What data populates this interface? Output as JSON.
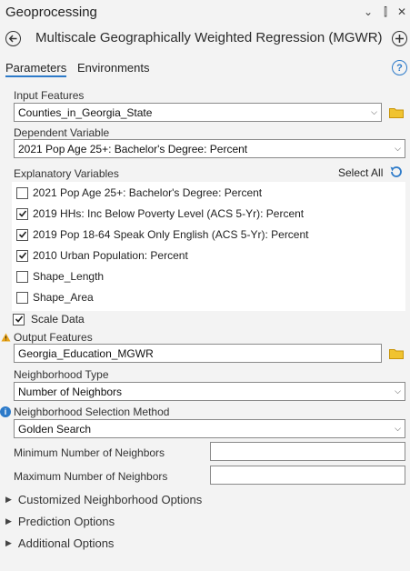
{
  "header": {
    "title": "Geoprocessing",
    "controls": [
      "⌄",
      "⫿",
      "✕"
    ]
  },
  "tool": {
    "title": "Multiscale Geographically Weighted Regression (MGWR)"
  },
  "tabs": [
    {
      "label": "Parameters",
      "active": true
    },
    {
      "label": "Environments",
      "active": false
    }
  ],
  "params": {
    "input_features": {
      "label": "Input Features",
      "value": "Counties_in_Georgia_State"
    },
    "dependent_variable": {
      "label": "Dependent Variable",
      "value": "2021 Pop Age 25+: Bachelor's Degree: Percent"
    },
    "explanatory": {
      "label": "Explanatory Variables",
      "select_all": "Select All",
      "items": [
        {
          "label": "2021 Pop Age 25+: Bachelor's Degree: Percent",
          "checked": false
        },
        {
          "label": "2019 HHs: Inc Below Poverty Level (ACS 5-Yr): Percent",
          "checked": true
        },
        {
          "label": "2019 Pop 18-64 Speak Only English (ACS 5-Yr): Percent",
          "checked": true
        },
        {
          "label": "2010 Urban Population: Percent",
          "checked": true
        },
        {
          "label": "Shape_Length",
          "checked": false
        },
        {
          "label": "Shape_Area",
          "checked": false
        }
      ]
    },
    "scale_data": {
      "label": "Scale Data",
      "checked": true
    },
    "output_features": {
      "label": "Output Features",
      "value": "Georgia_Education_MGWR"
    },
    "neighborhood_type": {
      "label": "Neighborhood Type",
      "value": "Number of Neighbors"
    },
    "neighborhood_method": {
      "label": "Neighborhood Selection Method",
      "value": "Golden Search"
    },
    "min_neighbors": {
      "label": "Minimum Number of Neighbors",
      "value": ""
    },
    "max_neighbors": {
      "label": "Maximum Number of Neighbors",
      "value": ""
    }
  },
  "sections": [
    "Customized Neighborhood Options",
    "Prediction Options",
    "Additional Options"
  ],
  "colors": {
    "accent": "#2c7ac9",
    "warning": "#e8a317",
    "folder": "#d9a400"
  }
}
